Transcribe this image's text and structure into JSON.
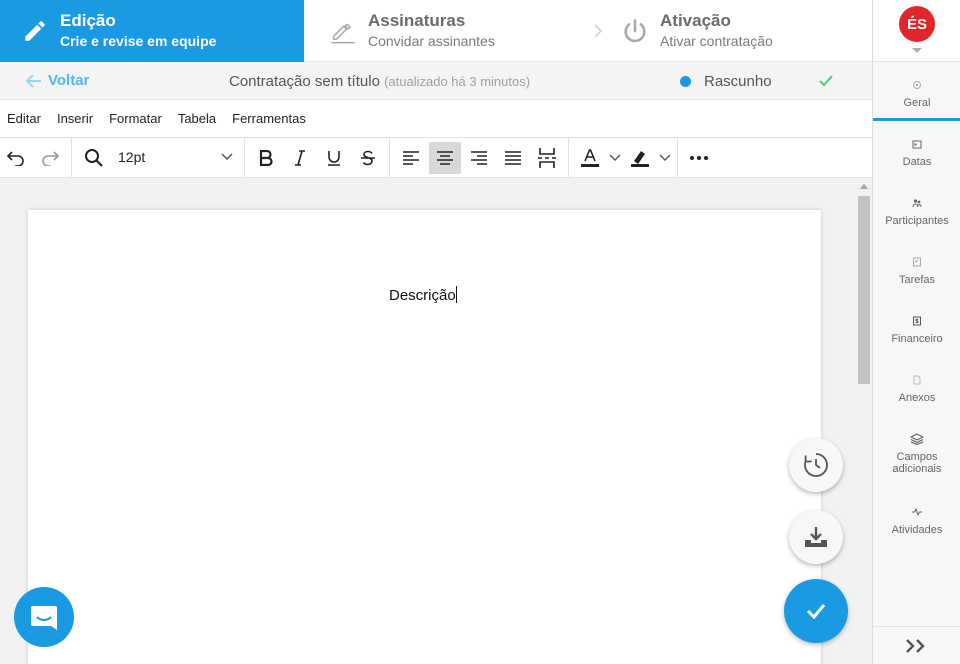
{
  "stepper": {
    "steps": [
      {
        "title": "Edição",
        "subtitle": "Crie e revise em equipe",
        "icon": "pencil-icon"
      },
      {
        "title": "Assinaturas",
        "subtitle": "Convidar assinantes",
        "icon": "signature-icon"
      },
      {
        "title": "Ativação",
        "subtitle": "Ativar contratação",
        "icon": "power-icon"
      }
    ]
  },
  "subheader": {
    "back_label": "Voltar",
    "doc_title": "Contratação sem título",
    "updated": "(atualizado há 3 minutos)",
    "status_label": "Rascunho"
  },
  "menubar": {
    "items": [
      "Editar",
      "Inserir",
      "Formatar",
      "Tabela",
      "Ferramentas"
    ]
  },
  "toolbar": {
    "font_size": "12pt"
  },
  "document": {
    "text": "Descrição"
  },
  "user": {
    "initials": "ÉS"
  },
  "sidebar": {
    "items": [
      {
        "label": "Geral",
        "icon": "settings-icon"
      },
      {
        "label": "Datas",
        "icon": "calendar-icon"
      },
      {
        "label": "Participantes",
        "icon": "people-icon"
      },
      {
        "label": "Tarefas",
        "icon": "tasks-icon"
      },
      {
        "label": "Financeiro",
        "icon": "money-icon"
      },
      {
        "label": "Anexos",
        "icon": "attachment-icon"
      },
      {
        "label": "Campos adicionais",
        "icon": "layers-icon"
      },
      {
        "label": "Atividades",
        "icon": "activity-icon"
      }
    ]
  },
  "colors": {
    "accent": "#1b9ae4",
    "back_link": "#4fb8ec",
    "status_dot": "#2196e8",
    "saved_check": "#4cd06a",
    "avatar": "#e0262a"
  }
}
